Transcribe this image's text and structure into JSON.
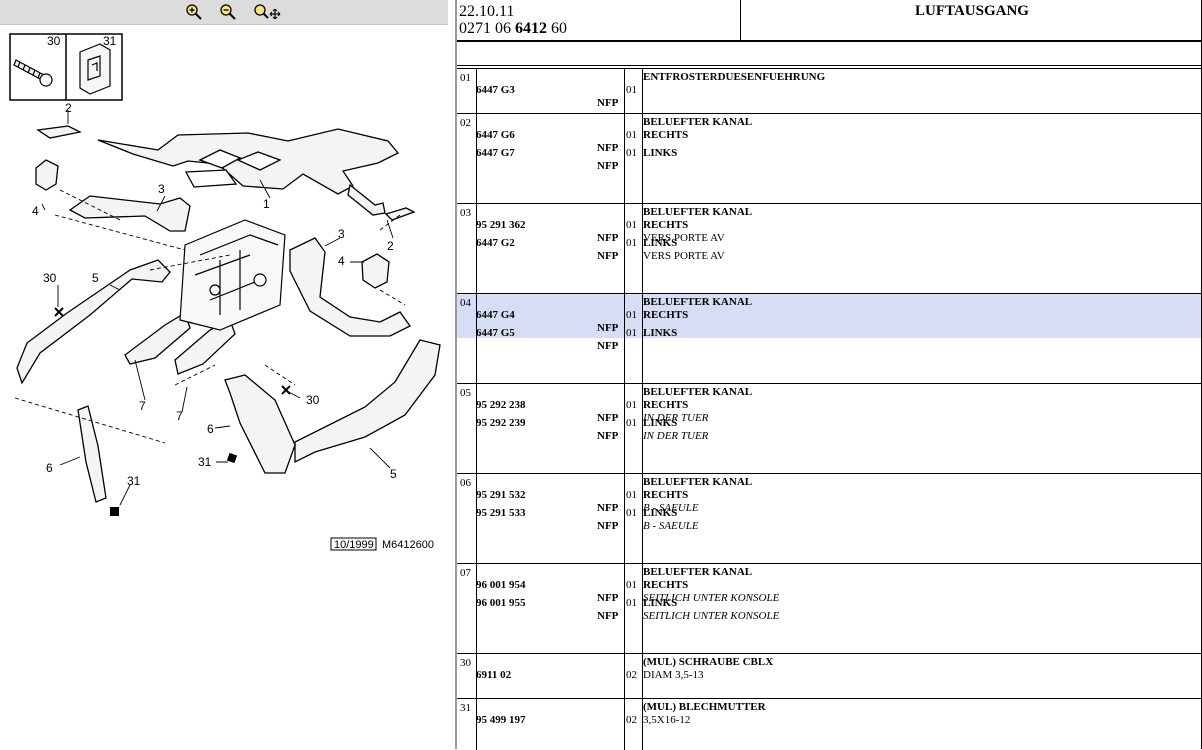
{
  "toolbar": {
    "zoom_in_icon": "zoom-in-icon",
    "zoom_out_icon": "zoom-out-icon",
    "zoom_fit_icon": "zoom-pan-icon"
  },
  "diagram": {
    "callouts": [
      "30",
      "31",
      "2",
      "3",
      "4",
      "1",
      "3",
      "2",
      "4",
      "30",
      "5",
      "7",
      "7",
      "30",
      "6",
      "5",
      "6",
      "31",
      "31"
    ],
    "date_label": "10/1999",
    "ref_label": "M6412600"
  },
  "header": {
    "date": "22.10.11",
    "code_pre": "0271 06 ",
    "code_bold": "6412",
    "code_post": " 60",
    "title": "LUFTAUSGANG"
  },
  "groups": [
    {
      "num": "01",
      "rows": [
        {
          "part": "6447 G3",
          "qty": "01",
          "nfp": "NFP",
          "desc": [
            {
              "t": "ENTFROSTERDUESENFUEHRUNG",
              "s": "b"
            }
          ]
        }
      ]
    },
    {
      "num": "02",
      "rows": [
        {
          "part": "6447 G6",
          "qty": "01",
          "nfp": "NFP",
          "desc": [
            {
              "t": "BELUEFTER KANAL",
              "s": "b"
            },
            {
              "t": "RECHTS",
              "s": "b"
            }
          ]
        },
        {
          "part": "6447 G7",
          "qty": "01",
          "nfp": "NFP",
          "desc": [
            {
              "t": "LINKS",
              "s": "b"
            }
          ]
        }
      ]
    },
    {
      "num": "03",
      "rows": [
        {
          "part": "95 291 362",
          "qty": "01",
          "nfp": "NFP",
          "desc": [
            {
              "t": "BELUEFTER KANAL",
              "s": "b"
            },
            {
              "t": "RECHTS",
              "s": "b"
            },
            {
              "t": "VERS PORTE AV",
              "s": "n"
            }
          ]
        },
        {
          "part": "6447 G2",
          "qty": "01",
          "nfp": "NFP",
          "desc": [
            {
              "t": "LINKS",
              "s": "b"
            },
            {
              "t": "VERS PORTE AV",
              "s": "n"
            }
          ]
        }
      ]
    },
    {
      "num": "04",
      "selected": true,
      "rows": [
        {
          "part": "6447 G4",
          "qty": "01",
          "nfp": "NFP",
          "desc": [
            {
              "t": "BELUEFTER KANAL",
              "s": "b"
            },
            {
              "t": "RECHTS",
              "s": "b"
            }
          ]
        },
        {
          "part": "6447 G5",
          "qty": "01",
          "nfp": "NFP",
          "desc": [
            {
              "t": "LINKS",
              "s": "b"
            }
          ]
        }
      ]
    },
    {
      "num": "05",
      "rows": [
        {
          "part": "95 292 238",
          "qty": "01",
          "nfp": "NFP",
          "desc": [
            {
              "t": "BELUEFTER KANAL",
              "s": "b"
            },
            {
              "t": "RECHTS",
              "s": "b"
            },
            {
              "t": "IN DER TUER",
              "s": "i"
            }
          ]
        },
        {
          "part": "95 292 239",
          "qty": "01",
          "nfp": "NFP",
          "desc": [
            {
              "t": "LINKS",
              "s": "b"
            },
            {
              "t": "IN DER TUER",
              "s": "i"
            }
          ]
        }
      ]
    },
    {
      "num": "06",
      "rows": [
        {
          "part": "95 291 532",
          "qty": "01",
          "nfp": "NFP",
          "desc": [
            {
              "t": "BELUEFTER KANAL",
              "s": "b"
            },
            {
              "t": "RECHTS",
              "s": "b"
            },
            {
              "t": "B - SAEULE",
              "s": "i"
            }
          ]
        },
        {
          "part": "95 291 533",
          "qty": "01",
          "nfp": "NFP",
          "desc": [
            {
              "t": "LINKS",
              "s": "b"
            },
            {
              "t": "B - SAEULE",
              "s": "i"
            }
          ]
        }
      ]
    },
    {
      "num": "07",
      "rows": [
        {
          "part": "96 001 954",
          "qty": "01",
          "nfp": "NFP",
          "desc": [
            {
              "t": "BELUEFTER KANAL",
              "s": "b"
            },
            {
              "t": "RECHTS",
              "s": "b"
            },
            {
              "t": "SEITLICH UNTER KONSOLE",
              "s": "i"
            }
          ]
        },
        {
          "part": "96 001 955",
          "qty": "01",
          "nfp": "NFP",
          "desc": [
            {
              "t": "LINKS",
              "s": "b"
            },
            {
              "t": "SEITLICH UNTER KONSOLE",
              "s": "i"
            }
          ]
        }
      ]
    },
    {
      "num": "30",
      "rows": [
        {
          "part": "6911 02",
          "qty": "02",
          "nfp": "",
          "desc": [
            {
              "t": "(MUL) SCHRAUBE CBLX",
              "s": "b"
            },
            {
              "t": "DIAM 3,5-13",
              "s": "n"
            }
          ]
        }
      ]
    },
    {
      "num": "31",
      "rows": [
        {
          "part": "95 499 197",
          "qty": "02",
          "nfp": "",
          "desc": [
            {
              "t": "(MUL) BLECHMUTTER",
              "s": "b"
            },
            {
              "t": "3,5X16-12",
              "s": "n"
            }
          ]
        }
      ]
    }
  ]
}
